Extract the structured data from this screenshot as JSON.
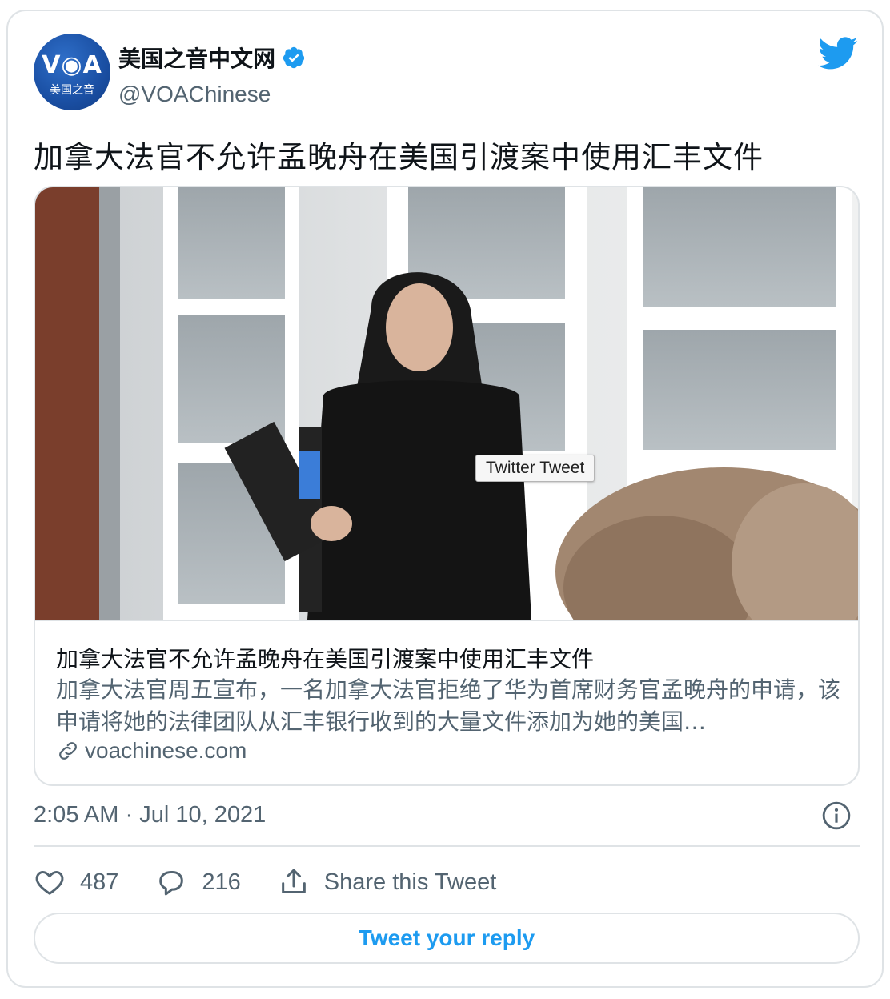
{
  "author": {
    "avatar_text": "V◉A",
    "avatar_subtext": "美国之音",
    "display_name": "美国之音中文网",
    "handle": "@VOAChinese",
    "verified": true
  },
  "tweet": {
    "text": "加拿大法官不允许孟晚舟在美国引渡案中使用汇丰文件",
    "time": "2:05 AM",
    "separator": "·",
    "date": "Jul 10, 2021"
  },
  "link_card": {
    "title": "加拿大法官不允许孟晚舟在美国引渡案中使用汇丰文件",
    "description": "加拿大法官周五宣布，一名加拿大法官拒绝了华为首席财务官孟晚舟的申请，该申请将她的法律团队从汇丰银行收到的大量文件添加为她的美国…",
    "domain": "voachinese.com"
  },
  "tooltip": {
    "text": "Twitter Tweet"
  },
  "actions": {
    "likes": "487",
    "replies": "216",
    "share_label": "Share this Tweet"
  },
  "reply_button": {
    "label": "Tweet your reply"
  },
  "colors": {
    "accent": "#1d9bf0",
    "secondary_text": "#536471",
    "border": "#dfe3e6"
  }
}
